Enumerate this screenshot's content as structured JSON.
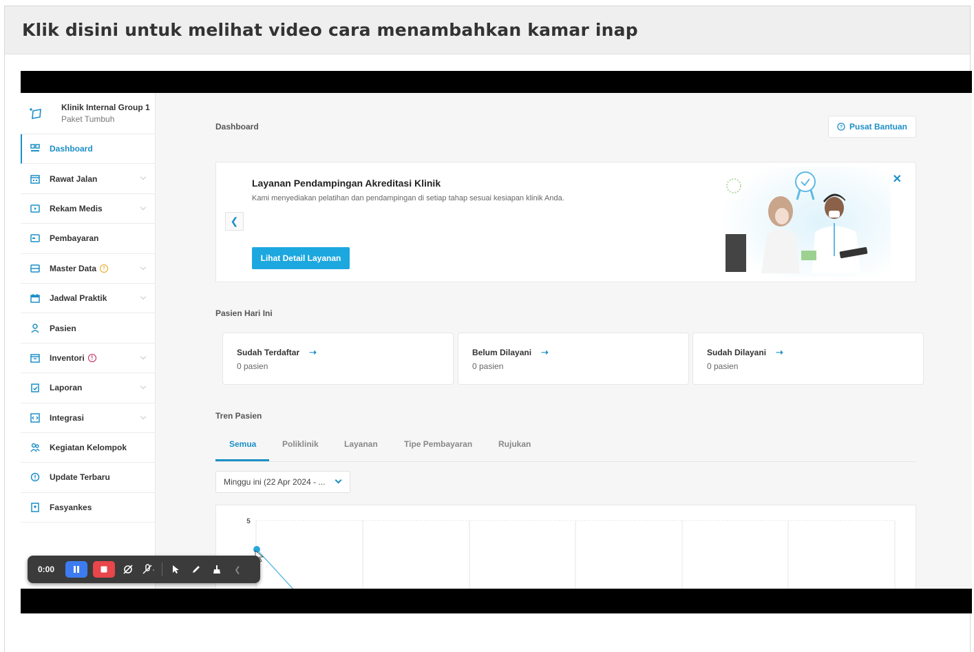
{
  "page": {
    "header_title": "Klik disini untuk melihat video cara menambahkan kamar inap"
  },
  "clinic": {
    "name": "Klinik Internal Group 1",
    "plan": "Paket Tumbuh"
  },
  "sidebar": {
    "items": [
      {
        "label": "Dashboard",
        "icon": "dashboard-icon",
        "active": true
      },
      {
        "label": "Rawat Jalan",
        "icon": "outpatient-icon"
      },
      {
        "label": "Rekam Medis",
        "icon": "medical-record-icon"
      },
      {
        "label": "Pembayaran",
        "icon": "payment-icon"
      },
      {
        "label": "Master Data",
        "icon": "master-data-icon"
      },
      {
        "label": "Jadwal Praktik",
        "icon": "calendar-icon"
      },
      {
        "label": "Pasien",
        "icon": "patient-icon"
      },
      {
        "label": "Inventori",
        "icon": "inventory-icon"
      },
      {
        "label": "Laporan",
        "icon": "report-icon"
      },
      {
        "label": "Integrasi",
        "icon": "integration-icon"
      },
      {
        "label": "Kegiatan Kelompok",
        "icon": "group-activity-icon"
      },
      {
        "label": "Update Terbaru",
        "icon": "update-icon"
      },
      {
        "label": "Fasyankes",
        "icon": "facility-icon"
      }
    ]
  },
  "main": {
    "breadcrumb": "Dashboard",
    "help_button": "Pusat Bantuan",
    "banner": {
      "title": "Layanan Pendampingan Akreditasi Klinik",
      "description": "Kami menyediakan pelatihan dan pendampingan di setiap tahap sesuai kesiapan klinik Anda.",
      "cta": "Lihat Detail Layanan"
    },
    "today_label": "Pasien Hari Ini",
    "stats": [
      {
        "title": "Sudah Terdaftar",
        "value": "0 pasien"
      },
      {
        "title": "Belum Dilayani",
        "value": "0 pasien"
      },
      {
        "title": "Sudah Dilayani",
        "value": "0 pasien"
      }
    ],
    "trend_label": "Tren Pasien",
    "tabs": [
      "Semua",
      "Poliklinik",
      "Layanan",
      "Tipe Pembayaran",
      "Rujukan"
    ],
    "week_select": "Minggu ini (22 Apr 2024 - ...",
    "chart_y_tick": "5"
  },
  "recorder": {
    "time": "0:00"
  },
  "colors": {
    "accent": "#1c8fc7",
    "cta": "#1ca7df",
    "record_red": "#e8464a",
    "pause_blue": "#3d7cf0"
  }
}
